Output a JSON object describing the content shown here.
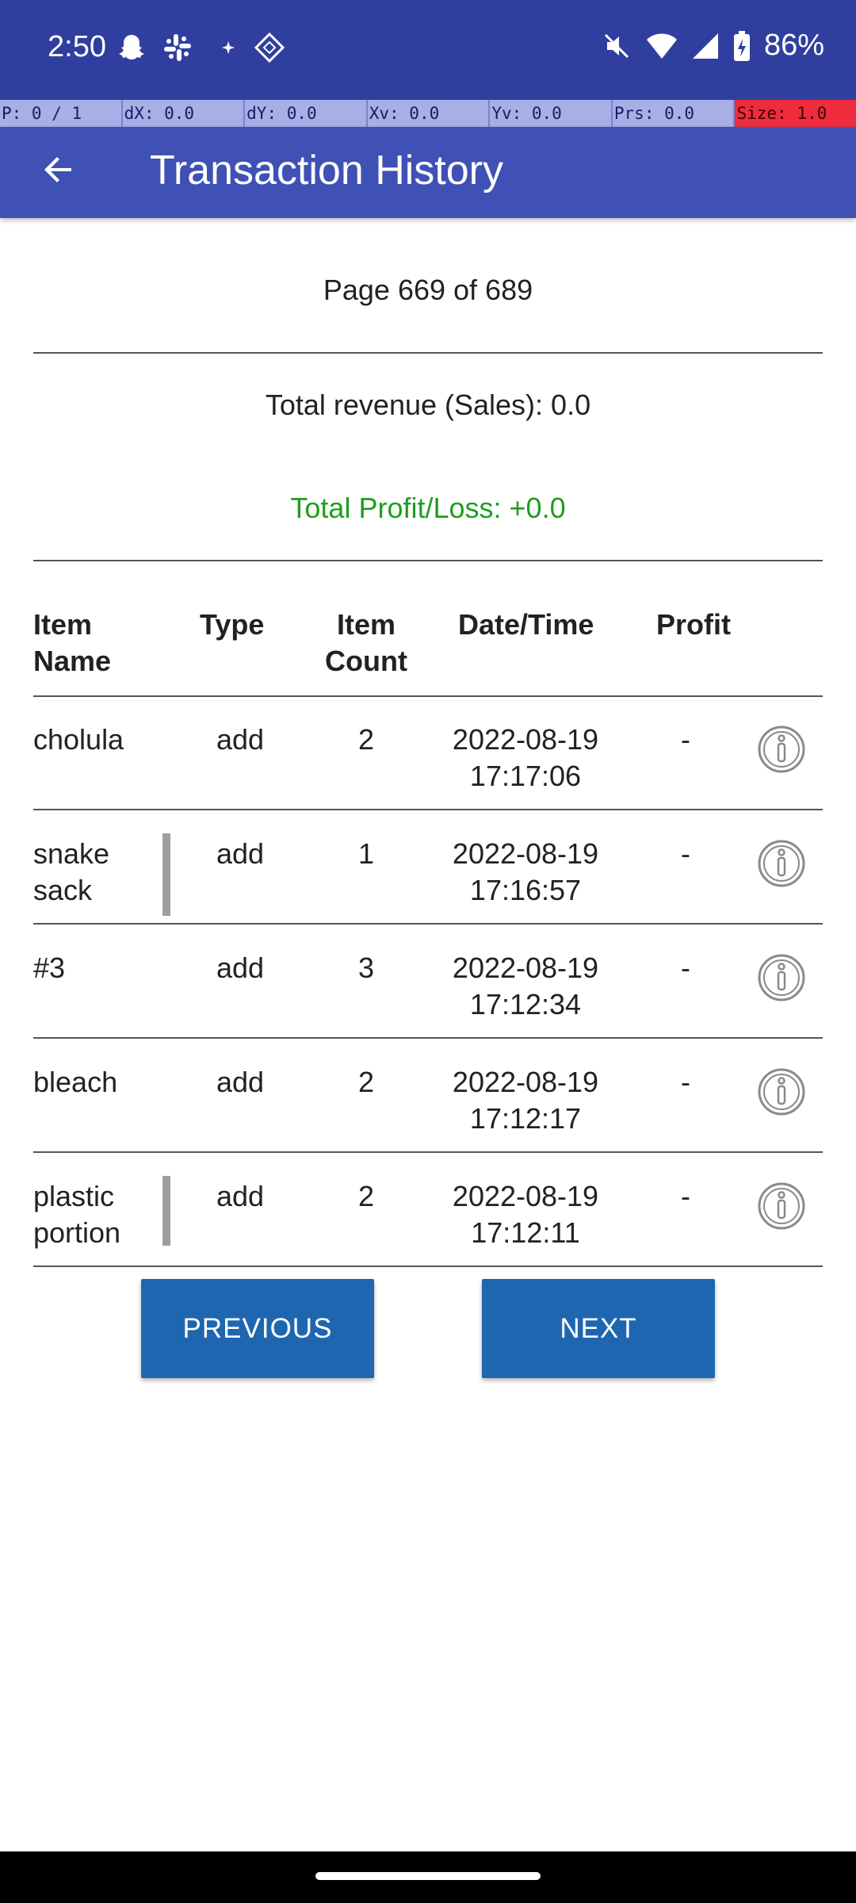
{
  "status_bar": {
    "time": "2:50",
    "battery": "86%",
    "notification_icons": [
      "snapchat-icon",
      "slack-icon",
      "sparkle-icon",
      "app-diamond-icon"
    ],
    "system_icons": [
      "mute-icon",
      "wifi-icon",
      "signal-icon",
      "battery-charging-icon"
    ]
  },
  "pointer_overlay": {
    "p": "P: 0 / 1",
    "dx": "dX: 0.0",
    "dy": "dY: 0.0",
    "xv": "Xv: 0.0",
    "yv": "Yv: 0.0",
    "prs": "Prs: 0.0",
    "size": "Size: 1.0"
  },
  "app_bar": {
    "title": "Transaction History",
    "back_icon": "arrow-back-icon"
  },
  "summary": {
    "page": "Page 669 of 689",
    "revenue": "Total revenue (Sales): 0.0",
    "profit_loss": "Total Profit/Loss: +0.0"
  },
  "table": {
    "headers": {
      "item_name": "Item\nName",
      "type": "Type",
      "item_count": "Item\nCount",
      "date_time": "Date/Time",
      "profit": "Profit"
    },
    "rows": [
      {
        "name": "cholula",
        "type": "add",
        "count": "2",
        "date": "2022-08-19",
        "time": "17:17:06",
        "profit": "-"
      },
      {
        "name": "snake\nsack",
        "type": "add",
        "count": "1",
        "date": "2022-08-19",
        "time": "17:16:57",
        "profit": "-"
      },
      {
        "name": "#3",
        "type": "add",
        "count": "3",
        "date": "2022-08-19",
        "time": "17:12:34",
        "profit": "-"
      },
      {
        "name": "bleach",
        "type": "add",
        "count": "2",
        "date": "2022-08-19",
        "time": "17:12:17",
        "profit": "-"
      },
      {
        "name": "plastic\nportion",
        "type": "add",
        "count": "2",
        "date": "2022-08-19",
        "time": "17:12:11",
        "profit": "-"
      }
    ]
  },
  "buttons": {
    "previous": "PREVIOUS",
    "next": "NEXT"
  },
  "colors": {
    "status_bar": "#303f9f",
    "app_bar": "#3f51b5",
    "button": "#1e66b0",
    "profit_text": "#1e9e1e"
  }
}
